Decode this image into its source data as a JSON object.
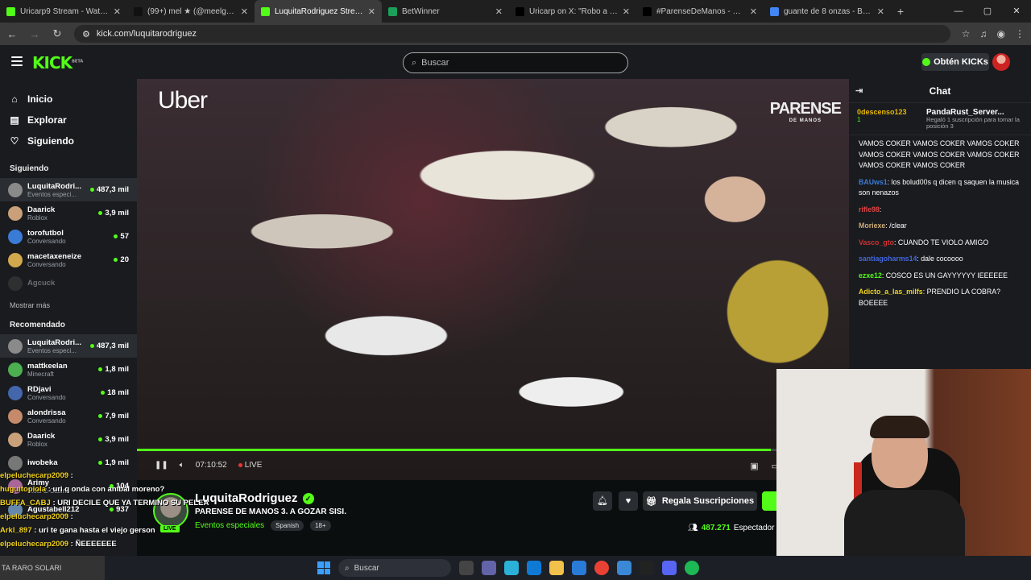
{
  "browser": {
    "tabs": [
      {
        "label": "Uricarp9 Stream - Watch Live o",
        "color": "#53fc18",
        "active": false
      },
      {
        "label": "(99+) mel ★ (@meelgan) | TikTo",
        "color": "#111111",
        "active": false
      },
      {
        "label": "LuquitaRodriguez Stream",
        "color": "#53fc18",
        "active": true
      },
      {
        "label": "BetWinner",
        "color": "#1aa05a",
        "active": false
      },
      {
        "label": "Uricarp on X: \"Robo a Merruel\"",
        "color": "#000000",
        "active": false
      },
      {
        "label": "#ParenseDeManos - Search / X",
        "color": "#000000",
        "active": false
      },
      {
        "label": "guante de 8 onzas - Buscar co",
        "color": "#4285f4",
        "active": false
      }
    ],
    "url": "kick.com/luquitarodriguez"
  },
  "header": {
    "logo": "KICK",
    "logo_badge": "BETA",
    "search_placeholder": "Buscar",
    "get_kicks": "Obtén KICKs"
  },
  "sidebar": {
    "nav": [
      {
        "icon": "⌂",
        "label": "Inicio"
      },
      {
        "icon": "▤",
        "label": "Explorar"
      },
      {
        "icon": "♡",
        "label": "Siguiendo"
      }
    ],
    "following_title": "Siguiendo",
    "following": [
      {
        "name": "LuquitaRodri...",
        "category": "Eventos especi...",
        "viewers": "487,3 mil",
        "color": "#8a8a8a"
      },
      {
        "name": "Daarick",
        "category": "Roblox",
        "viewers": "3,9 mil",
        "color": "#c9a07a"
      },
      {
        "name": "torofutbol",
        "category": "Conversando",
        "viewers": "57",
        "color": "#3a7bd5"
      },
      {
        "name": "macetaxeneize",
        "category": "Conversando",
        "viewers": "20",
        "color": "#d1a84b"
      },
      {
        "name": "Agcuck",
        "category": "",
        "viewers": "",
        "color": "#555555"
      }
    ],
    "show_more": "Mostrar más",
    "recommended_title": "Recomendado",
    "recommended": [
      {
        "name": "LuquitaRodri...",
        "category": "Eventos especi...",
        "viewers": "487,3 mil",
        "color": "#8a8a8a"
      },
      {
        "name": "mattkeelan",
        "category": "Minecraft",
        "viewers": "1,8 mil",
        "color": "#4caf50"
      },
      {
        "name": "RDjavi",
        "category": "Conversando",
        "viewers": "18 mil",
        "color": "#4466aa"
      },
      {
        "name": "alondrissa",
        "category": "Conversando",
        "viewers": "7,9 mil",
        "color": "#c58a6a"
      },
      {
        "name": "Daarick",
        "category": "Roblox",
        "viewers": "3,9 mil",
        "color": "#c9a07a"
      },
      {
        "name": "iwobeka",
        "category": "",
        "viewers": "1,9 mil",
        "color": "#777777"
      },
      {
        "name": "Arimy",
        "category": "Slots & Casino",
        "viewers": "104",
        "color": "#aa6699"
      },
      {
        "name": "Agustabell212",
        "category": "",
        "viewers": "937",
        "color": "#6688aa"
      }
    ]
  },
  "player": {
    "sponsor": "Uber",
    "brand": "PARENSE",
    "brand_sub": "DE MANOS",
    "time": "07:10:52",
    "live": "LIVE",
    "progress": 0.89
  },
  "stream_info": {
    "streamer": "LuquitaRodriguez",
    "title": "PARENSE DE MANOS 3. A GOZAR SISI.",
    "category": "Eventos especiales",
    "tags": [
      "Spanish",
      "18+"
    ],
    "live_badge": "LIVE",
    "gift_label": "Regala Suscripciones",
    "viewers": "487.271",
    "viewers_label": "Espectador"
  },
  "chat": {
    "title": "Chat",
    "pinned_user": "0descenso123",
    "pinned_user_count": "1",
    "gift_user": "PandaRust_Server...",
    "gift_text": "Regaló 1 suscripción para tomar la posición 3",
    "messages": [
      {
        "user": "",
        "text": "VAMOS COKER VAMOS COKER VAMOS COKER VAMOS COKER VAMOS COKER VAMOS COKER VAMOS COKER VAMOS COKER",
        "color": "#ffffff"
      },
      {
        "user": "BAUws1",
        "text": "los bolud00s q dicen q saquen la musica son nenazos",
        "color": "#3a7bd5"
      },
      {
        "user": "rifle98",
        "text": "",
        "color": "#e04444"
      },
      {
        "user": "Moriexe",
        "text": "/clear",
        "color": "#ccaa77"
      },
      {
        "user": "Vasco_gto",
        "text": "CUANDO TE VIOLO AMIGO",
        "color": "#cc3333"
      },
      {
        "user": "santiagoharms14",
        "text": "dale cocoooo",
        "color": "#4466dd"
      },
      {
        "user": "ezxe12",
        "text": "COSCO ES UN GAYYYYYY IEEEEEE",
        "color": "#53fc18"
      },
      {
        "user": "Adicto_a_las_milfs",
        "text": "PRENDIO LA COBRA? BOEEEE",
        "color": "#f2d31b"
      }
    ]
  },
  "overlay_chat": [
    {
      "user": "elpeluchecarp2009",
      "text": ""
    },
    {
      "user": "huguitopiola",
      "text": "uri q onda con anibal moreno?"
    },
    {
      "user": "BUFFA_CABJ",
      "text": "URI DECILE QUE YA TERMINO SU PELEA"
    },
    {
      "user": "elpeluchecarp2009",
      "text": ""
    },
    {
      "user": "Arkl_897",
      "text": "uri te gana hasta el viejo gerson"
    },
    {
      "user": "elpeluchecarp2009",
      "text": "ÑEEEEEEE"
    }
  ],
  "taskbar": {
    "now_playing": "TA RARO SOLARI",
    "search_placeholder": "Buscar"
  }
}
